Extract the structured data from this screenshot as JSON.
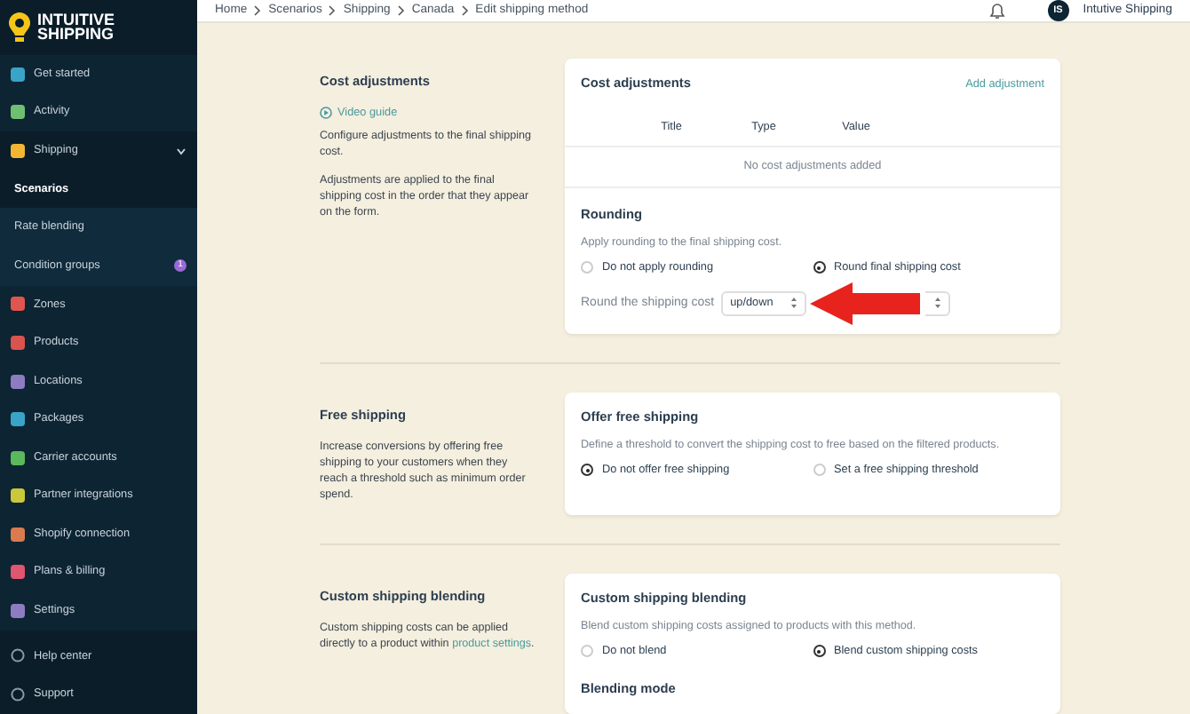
{
  "brand": {
    "line_1": "INTUITIVE",
    "line_2": "SHIPPING"
  },
  "sidebar": {
    "items": [
      {
        "label": "Get started",
        "color": "#3aa3c8"
      },
      {
        "label": "Activity",
        "color": "#6fbf73"
      },
      {
        "label": "Shipping",
        "color": "#f2b632",
        "expanded": true,
        "children": [
          {
            "label": "Scenarios",
            "selected": true
          },
          {
            "label": "Rate blending",
            "selected": false
          },
          {
            "label": "Condition groups",
            "selected": false,
            "badge": "1"
          }
        ]
      },
      {
        "label": "Zones",
        "color": "#e0554f"
      },
      {
        "label": "Products",
        "color": "#d9534f"
      },
      {
        "label": "Locations",
        "color": "#8e7cc3"
      },
      {
        "label": "Packages",
        "color": "#3aa3c8"
      },
      {
        "label": "Carrier accounts",
        "color": "#5cb85c"
      },
      {
        "label": "Partner integrations",
        "color": "#c9c83a"
      },
      {
        "label": "Shopify connection",
        "color": "#d97b4f"
      },
      {
        "label": "Plans & billing",
        "color": "#e0556f"
      },
      {
        "label": "Settings",
        "color": "#8e7cc3"
      }
    ],
    "footer": [
      {
        "label": "Help center"
      },
      {
        "label": "Support"
      }
    ]
  },
  "breadcrumb": [
    "Home",
    "Scenarios",
    "Shipping",
    "Canada",
    "Edit shipping method"
  ],
  "account": {
    "initials": "IS",
    "name": "Intutive Shipping"
  },
  "sections": [
    {
      "kind": "adjustments",
      "title": "Cost adjustments",
      "video_link": "Video guide",
      "paragraphs": [
        "Configure adjustments to the final shipping cost.",
        "Adjustments are applied to the final shipping cost in the order that they appear on the form."
      ],
      "card": {
        "title": "Cost adjustments",
        "action": "Add adjustment",
        "columns": [
          "Title",
          "Type",
          "Value"
        ],
        "empty": "No cost adjustments added",
        "subtitle": "Rounding",
        "hint": "Apply rounding to the final shipping cost.",
        "options": [
          {
            "label": "Do not apply rounding",
            "selected": false
          },
          {
            "label": "Round final shipping cost",
            "selected": true
          }
        ],
        "select_label": "Round the shipping cost",
        "select_value": "up/down"
      }
    },
    {
      "kind": "simple",
      "title": "Free shipping",
      "paragraphs": [
        "Increase conversions by offering free shipping to your customers when they reach a threshold such as minimum order spend."
      ],
      "card": {
        "title": "Offer free shipping",
        "hint": "Define a threshold to convert the shipping cost to free based on the filtered products.",
        "options": [
          {
            "label": "Do not offer free shipping",
            "selected": true
          },
          {
            "label": "Set a free shipping threshold",
            "selected": false
          }
        ]
      }
    },
    {
      "kind": "blending",
      "title": "Custom shipping blending",
      "paragraphs": [
        "Custom shipping costs can be applied directly to a product within "
      ],
      "link": "product settings",
      "link_after": ".",
      "card": {
        "title": "Custom shipping blending",
        "hint": "Blend custom shipping costs assigned to products with this method.",
        "options": [
          {
            "label": "Do not blend",
            "selected": false
          },
          {
            "label": "Blend custom shipping costs",
            "selected": true
          }
        ],
        "subtitle": "Blending mode"
      }
    }
  ]
}
